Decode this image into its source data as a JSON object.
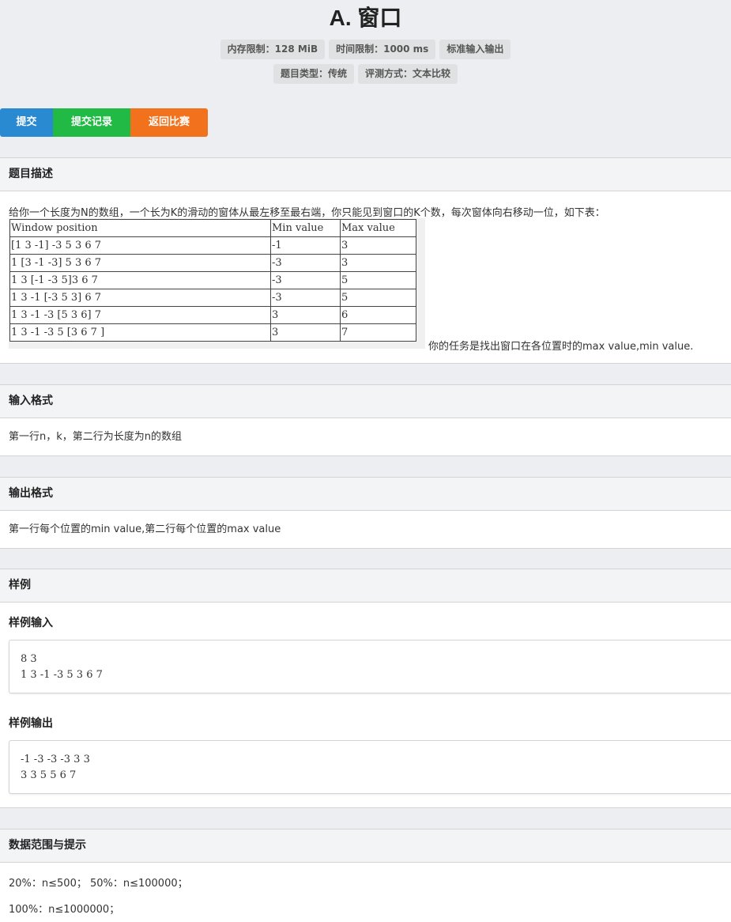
{
  "title": "A. 窗口",
  "badges_row1": [
    "内存限制：128 MiB",
    "时间限制：1000 ms",
    "标准输入输出"
  ],
  "badges_row2": [
    "题目类型：传统",
    "评测方式：文本比较"
  ],
  "buttons": {
    "submit": "提交",
    "records": "提交记录",
    "back": "返回比赛"
  },
  "description": {
    "heading": "题目描述",
    "intro": "给你一个长度为N的数组，一个长为K的滑动的窗体从最左移至最右端，你只能见到窗口的K个数，每次窗体向右移动一位，如下表：",
    "table": {
      "headers": [
        "Window position",
        "Min value",
        "Max value"
      ],
      "rows": [
        [
          "[1 3 -1] -3 5 3 6 7",
          "-1",
          "3"
        ],
        [
          "1 [3 -1 -3] 5 3 6 7",
          "-3",
          "3"
        ],
        [
          "1 3 [-1 -3 5]3 6 7",
          "-3",
          "5"
        ],
        [
          "1 3 -1 [-3 5 3] 6 7",
          "-3",
          "5"
        ],
        [
          "1 3 -1 -3 [5 3 6] 7",
          "3",
          "6"
        ],
        [
          "1 3 -1 -3 5 [3 6 7 ]",
          "3",
          "7"
        ]
      ]
    },
    "task": "你的任务是找出窗口在各位置时的max value,min value."
  },
  "input_format": {
    "heading": "输入格式",
    "text": "第一行n，k，第二行为长度为n的数组"
  },
  "output_format": {
    "heading": "输出格式",
    "text": "第一行每个位置的min value,第二行每个位置的max value"
  },
  "samples": {
    "heading": "样例",
    "input_label": "样例输入",
    "input_lines": [
      "8 3",
      "1 3 -1 -3 5 3 6 7"
    ],
    "output_label": "样例输出",
    "output_lines": [
      "-1 -3 -3 -3 3 3",
      "3 3 5 5 6 7"
    ]
  },
  "constraints": {
    "heading": "数据范围与提示",
    "line1": "20%：n≤500； 50%：n≤100000；",
    "line2": "100%：n≤1000000；"
  }
}
